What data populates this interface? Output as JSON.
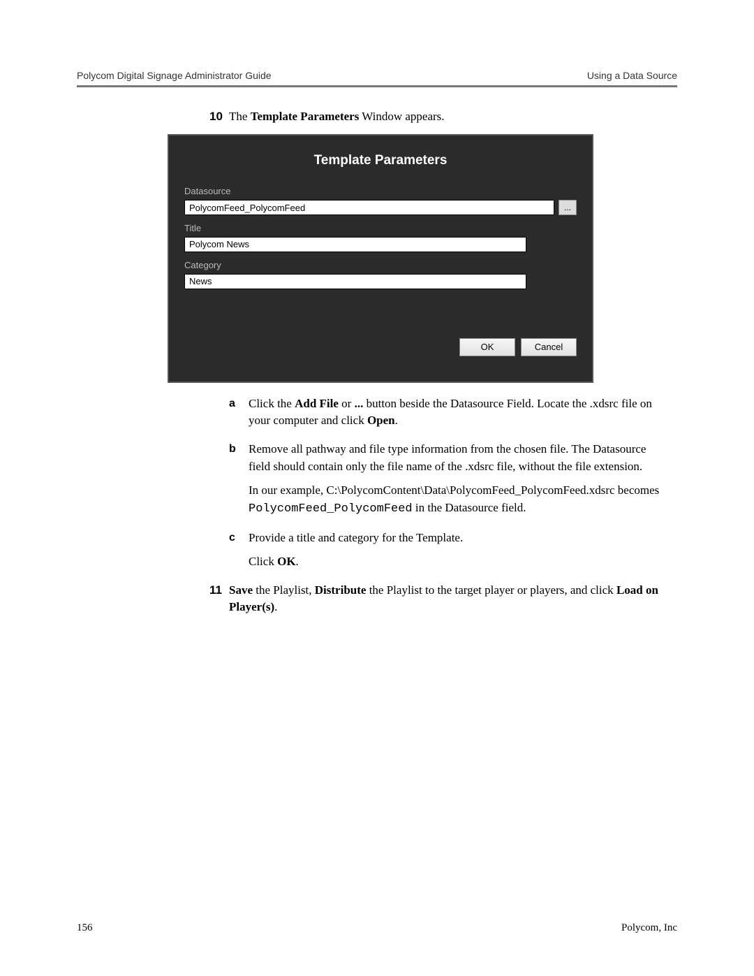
{
  "header": {
    "left": "Polycom Digital Signage Administrator Guide",
    "right": "Using a Data Source"
  },
  "step10": {
    "num": "10",
    "pre": "The ",
    "bold": "Template Parameters",
    "post": " Window appears."
  },
  "dialog": {
    "title": "Template Parameters",
    "datasource_label": "Datasource",
    "datasource_value": "PolycomFeed_PolycomFeed",
    "browse_label": "...",
    "title_label": "Title",
    "title_value": "Polycom News",
    "category_label": "Category",
    "category_value": "News",
    "ok": "OK",
    "cancel": "Cancel"
  },
  "sub_a": {
    "letter": "a",
    "t1": "Click the ",
    "b1": "Add File",
    "t2": " or ",
    "b2": "...",
    "t3": " button beside the Datasource Field. Locate the .xdsrc file on your computer and click ",
    "b3": "Open",
    "t4": "."
  },
  "sub_b": {
    "letter": "b",
    "p1": "Remove all pathway and file type information from the chosen file. The Datasource field should contain only the file name of the .xdsrc file, without the file extension.",
    "p2a": "In our example, C:\\PolycomContent\\Data\\PolycomFeed_PolycomFeed.xdsrc becomes ",
    "p2mono": "PolycomFeed_PolycomFeed",
    "p2b": " in the Datasource field."
  },
  "sub_c": {
    "letter": "c",
    "p1": "Provide a title and category for the Template.",
    "p2a": "Click ",
    "p2b": "OK",
    "p2c": "."
  },
  "step11": {
    "num": "11",
    "b1": "Save",
    "t1": " the Playlist, ",
    "b2": "Distribute",
    "t2": " the Playlist to the target player or players, and click ",
    "b3": "Load on Player(s)",
    "t3": "."
  },
  "footer": {
    "left": "156",
    "right": "Polycom, Inc"
  }
}
